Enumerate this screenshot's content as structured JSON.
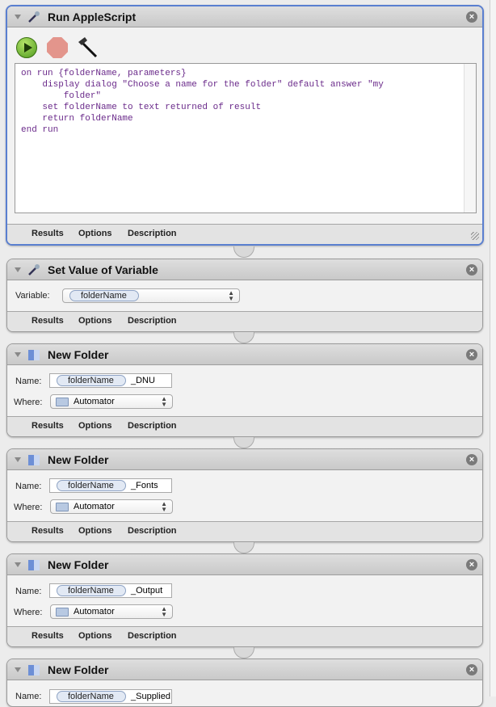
{
  "run_applescript": {
    "title": "Run AppleScript",
    "code": "on run {folderName, parameters}\n    display dialog \"Choose a name for the folder\" default answer \"my\n        folder\"\n    set folderName to text returned of result\n    return folderName\nend run"
  },
  "tabs": {
    "results": "Results",
    "options": "Options",
    "description": "Description"
  },
  "set_variable": {
    "title": "Set Value of Variable",
    "label": "Variable:",
    "value": "folderName"
  },
  "folders": [
    {
      "title": "New Folder",
      "name_label": "Name:",
      "token": "folderName",
      "suffix": "_DNU",
      "where_label": "Where:",
      "where": "Automator"
    },
    {
      "title": "New Folder",
      "name_label": "Name:",
      "token": "folderName",
      "suffix": "_Fonts",
      "where_label": "Where:",
      "where": "Automator"
    },
    {
      "title": "New Folder",
      "name_label": "Name:",
      "token": "folderName",
      "suffix": "_Output",
      "where_label": "Where:",
      "where": "Automator"
    },
    {
      "title": "New Folder",
      "name_label": "Name:",
      "token": "folderName",
      "suffix": "_Supplied"
    }
  ],
  "colors": {
    "selection": "#5a7fd0",
    "code": "#6a2a8a"
  }
}
